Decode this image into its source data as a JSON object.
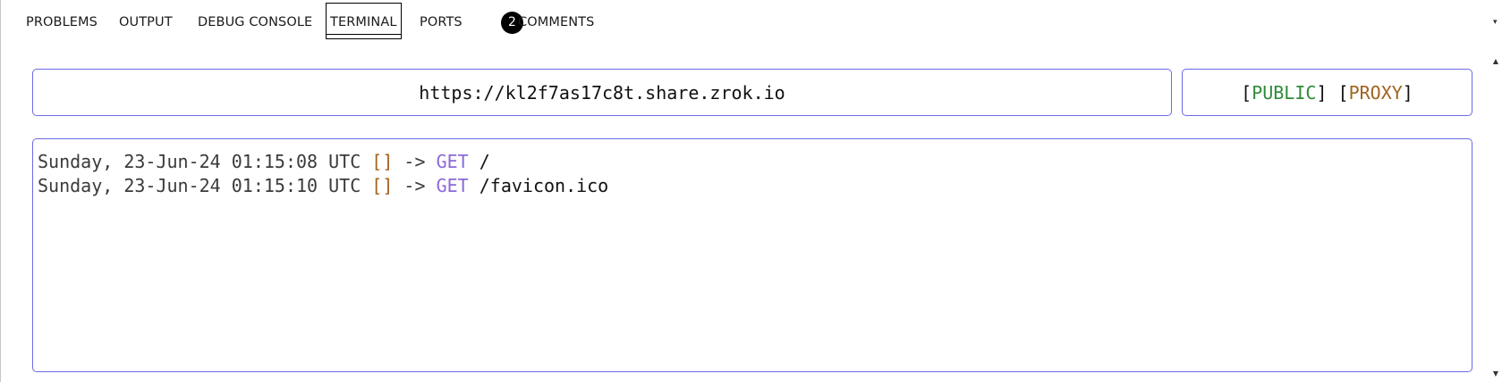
{
  "panel_tabs": [
    {
      "label": "PROBLEMS",
      "active": false
    },
    {
      "label": "OUTPUT",
      "active": false
    },
    {
      "label": "DEBUG CONSOLE",
      "active": false
    },
    {
      "label": "TERMINAL",
      "active": true
    },
    {
      "label": "PORTS",
      "active": false,
      "badge": "2"
    },
    {
      "label": "COMMENTS",
      "active": false
    }
  ],
  "share": {
    "url": "https://kl2f7as17c8t.share.zrok.io",
    "mode_tag": "PUBLIC",
    "backend_tag": "PROXY"
  },
  "log": [
    {
      "timestamp": "Sunday, 23-Jun-24 01:15:08 UTC",
      "brackets": "[]",
      "arrow": "->",
      "method": "GET",
      "path": "/"
    },
    {
      "timestamp": "Sunday, 23-Jun-24 01:15:10 UTC",
      "brackets": "[]",
      "arrow": "->",
      "method": "GET",
      "path": "/favicon.ico"
    }
  ],
  "icons": {
    "scroll_up": "chevron-up-icon",
    "scroll_down": "chevron-down-icon",
    "panel_menu": "chevron-down-icon"
  },
  "colors": {
    "panel_border": "#6a6ae8",
    "public_tag": "#2e8b3a",
    "proxy_tag": "#a0641e",
    "brackets": "#a0641e",
    "method": "#8a6ad8"
  }
}
